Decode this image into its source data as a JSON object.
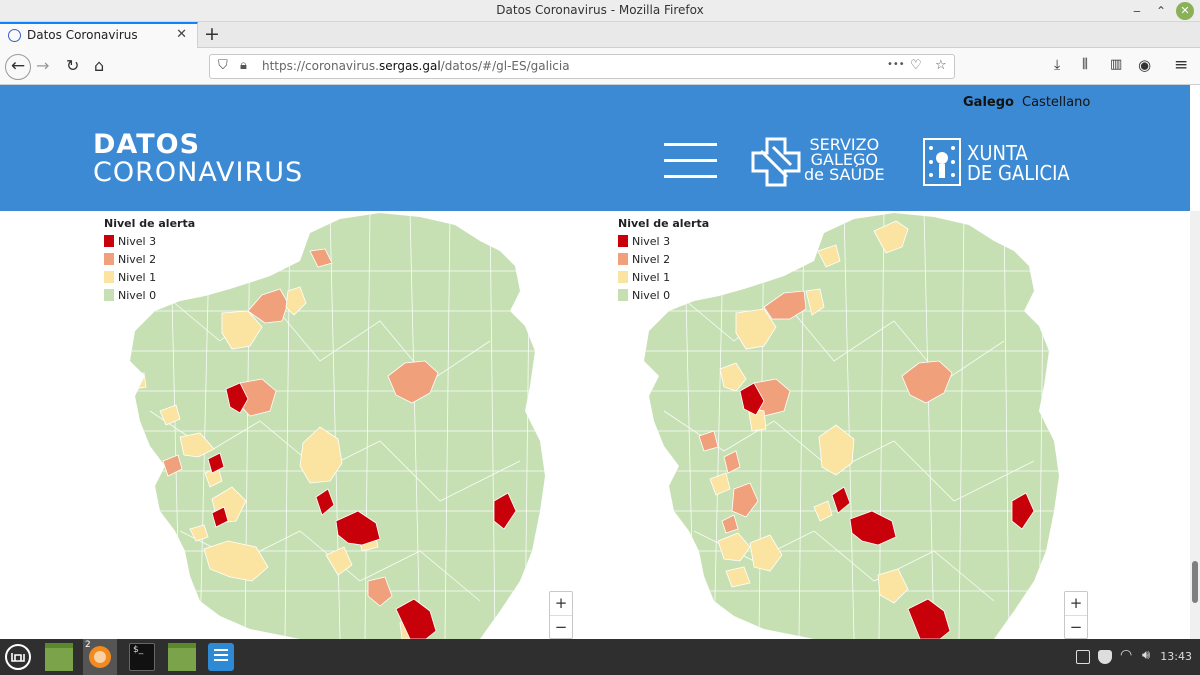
{
  "window": {
    "title": "Datos Coronavirus - Mozilla Firefox"
  },
  "tab": {
    "label": "Datos Coronavirus"
  },
  "urlbar": {
    "scheme": "https://coronavirus.",
    "host": "sergas.gal",
    "path": "/datos/#/gl-ES/galicia",
    "dots": "•••"
  },
  "header": {
    "lang_active": "Galego",
    "lang_other": "Castellano",
    "logo_line1": "DATOS",
    "logo_line2": "CORONAVIRUS",
    "sergas_line1": "SERVIZO",
    "sergas_line2": "GALEGO",
    "sergas_line3": "de SAÚDE",
    "xunta_line1": "XUNTA",
    "xunta_line2": "DE GALICIA"
  },
  "legend": {
    "title": "Nivel de alerta",
    "items": [
      {
        "label": "Nivel 3",
        "color": "#c8000a"
      },
      {
        "label": "Nivel 2",
        "color": "#f0a07a"
      },
      {
        "label": "Nivel 1",
        "color": "#fbe3a1"
      },
      {
        "label": "Nivel 0",
        "color": "#c6e0b4"
      }
    ]
  },
  "map": {
    "zoom_in": "+",
    "zoom_out": "−"
  },
  "taskbar": {
    "clock": "13:43",
    "firefox_badge": "2"
  }
}
